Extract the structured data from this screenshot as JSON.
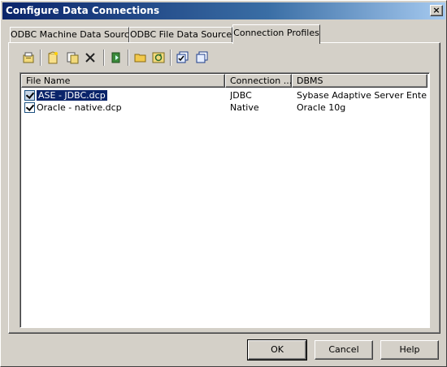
{
  "window": {
    "title": "Configure Data Connections",
    "close_label": "×"
  },
  "tabs": [
    {
      "label": "ODBC Machine Data Sources"
    },
    {
      "label": "ODBC File Data Sources"
    },
    {
      "label": "Connection Profiles"
    }
  ],
  "toolbar": {
    "icons": [
      "properties-icon",
      "new-icon",
      "copy-icon",
      "delete-icon",
      "test-connection-icon",
      "open-folder-icon",
      "refresh-icon",
      "select-all-icon",
      "deselect-all-icon"
    ]
  },
  "list": {
    "columns": [
      "File Name",
      "Connection ...",
      "DBMS"
    ],
    "rows": [
      {
        "checked": true,
        "selected": true,
        "file_name": "ASE - JDBC.dcp",
        "connection": "JDBC",
        "dbms": "Sybase Adaptive Server Enter..."
      },
      {
        "checked": true,
        "selected": false,
        "file_name": "Oracle - native.dcp",
        "connection": "Native",
        "dbms": "Oracle 10g"
      }
    ]
  },
  "buttons": {
    "ok": "OK",
    "cancel": "Cancel",
    "help": "Help"
  }
}
